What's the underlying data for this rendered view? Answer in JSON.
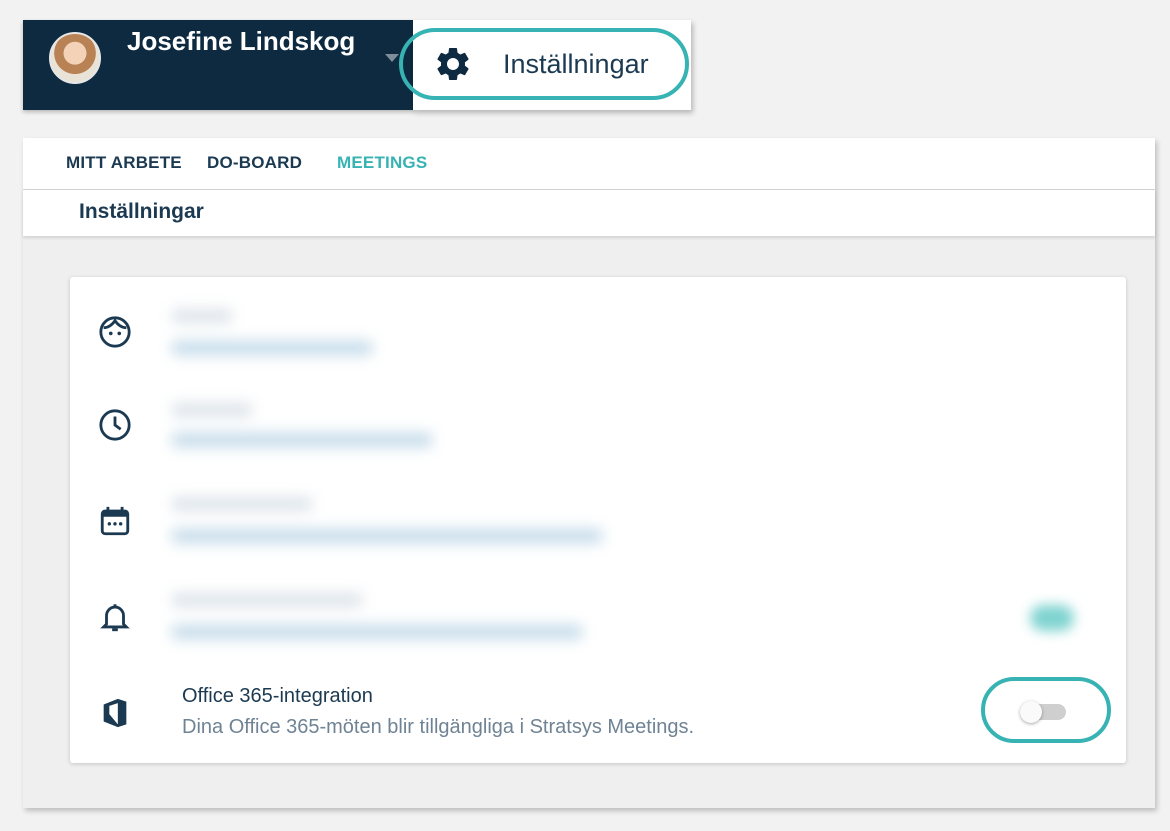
{
  "user": {
    "name": "Josefine Lindskog"
  },
  "menu": {
    "settings_label": "Inställningar",
    "settings_icon": "gear-icon"
  },
  "tabs": [
    {
      "label": "MITT ARBETE",
      "active": false
    },
    {
      "label": "DO-BOARD",
      "active": false
    },
    {
      "label": "MEETINGS",
      "active": true
    }
  ],
  "page": {
    "title": "Inställningar"
  },
  "settings": {
    "rows": [
      {
        "icon": "face-icon"
      },
      {
        "icon": "clock-icon"
      },
      {
        "icon": "calendar-icon"
      },
      {
        "icon": "bell-icon"
      }
    ],
    "office365": {
      "icon": "office-icon",
      "title": "Office 365-integration",
      "description": "Dina Office 365-möten blir tillgängliga i Stratsys Meetings.",
      "enabled": false
    }
  },
  "colors": {
    "accent": "#37b3b3",
    "navy": "#0e2a40",
    "text": "#1b3a52"
  }
}
